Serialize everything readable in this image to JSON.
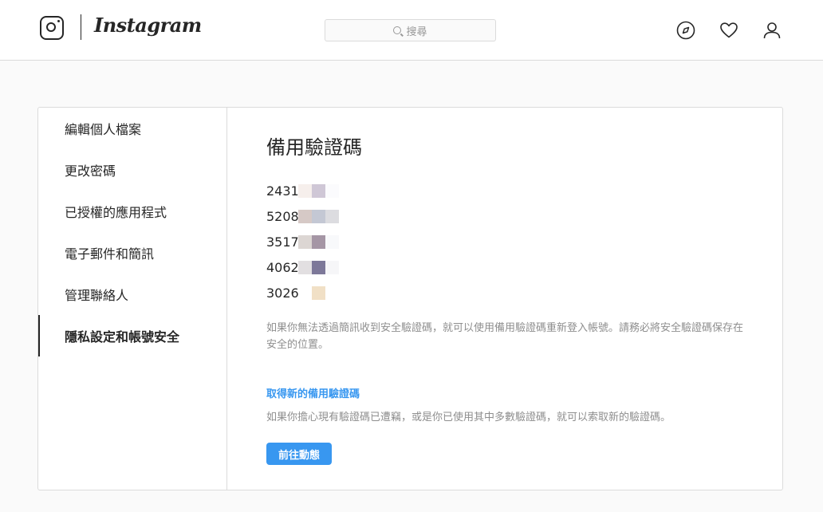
{
  "header": {
    "brand": "Instagram",
    "search_placeholder": "搜尋",
    "icons": [
      "instagram-logo-icon",
      "compass-icon",
      "heart-icon",
      "profile-icon"
    ]
  },
  "sidebar": {
    "items": [
      {
        "label": "編輯個人檔案"
      },
      {
        "label": "更改密碼"
      },
      {
        "label": "已授權的應用程式"
      },
      {
        "label": "電子郵件和簡訊"
      },
      {
        "label": "管理聯絡人"
      },
      {
        "label": "隱私設定和帳號安全",
        "active": true
      }
    ]
  },
  "main": {
    "title": "備用驗證碼",
    "codes": [
      {
        "visible": "2431"
      },
      {
        "visible": "5208"
      },
      {
        "visible": "3517"
      },
      {
        "visible": "4062"
      },
      {
        "visible": "3026"
      }
    ],
    "description": "如果你無法透過簡訊收到安全驗證碼，就可以使用備用驗證碼重新登入帳號。請務必將安全驗證碼保存在安全的位置。",
    "new_codes_link": "取得新的備用驗證碼",
    "new_codes_description": "如果你擔心現有驗證碼已遭竊，或是你已使用其中多數驗證碼，就可以索取新的驗證碼。",
    "button_label": "前往動態"
  },
  "colors": {
    "accent": "#3897f0",
    "text": "#262626",
    "secondary_text": "#8e8e8e",
    "border": "#dbdbdb",
    "background": "#fafafa"
  }
}
